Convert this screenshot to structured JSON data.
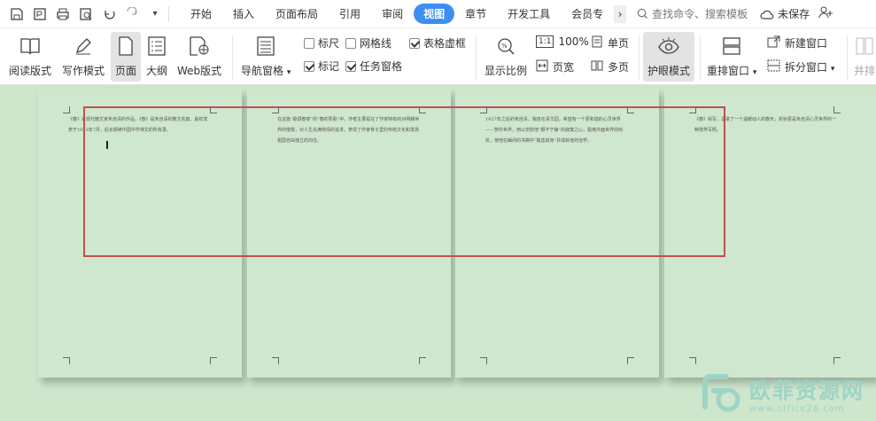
{
  "tabs": [
    "开始",
    "插入",
    "页面布局",
    "引用",
    "审阅",
    "视图",
    "章节",
    "开发工具",
    "会员专"
  ],
  "active_tab": "视图",
  "search": {
    "label": "查找命令、搜索模板"
  },
  "status": {
    "unsaved": "未保存"
  },
  "ribbon": {
    "read_mode": "阅读版式",
    "write_mode": "写作模式",
    "page": "页面",
    "outline": "大纲",
    "web": "Web版式",
    "nav_pane": "导航窗格",
    "ruler": "标尺",
    "gridlines": "网格线",
    "table_gridlines": "表格虚框",
    "markup": "标记",
    "task_pane": "任务窗格",
    "zoom_ratio": "显示比例",
    "zoom_100": "100%",
    "page_width": "页宽",
    "single_page": "单页",
    "multi_page": "多页",
    "eye_care": "护眼模式",
    "rearrange": "重排窗口",
    "new_window": "新建窗口",
    "split_window": "拆分窗口",
    "side_by_side": "并排"
  },
  "checkboxes": {
    "ruler": false,
    "gridlines": false,
    "table_gridlines": true,
    "markup": true,
    "task_pane": true
  },
  "pages": [
    {
      "text": "《春》是现代散文家朱自清的作品。《春》是朱自清的散文名篇。最初发表于1933年7月，后长期被中国中学课文的所收录。"
    },
    {
      "text": "在这篇“歌颂春意”的“春的赞歌”中，作者主要是在了作家特有的对明朗世界的憧憬，对人生充满热情的追求，表现了作家骨子里的传统文化和发扬祖国自由独立的向往。"
    },
    {
      "text": "1927年之后的朱自清，独自在清华园，希望有一个更和谐的心灵世界——梦的世界，用以安慰他“颇不宁静”的寂寞之心，脱离外面世界的纷扰，使他在幽闭的书斋中“独善其身”并成就他的治学。"
    },
    {
      "text": "《春》绘写，讴歌了一个温暖动人的春天，折射更是朱自清心灵世界的一种境界写照。"
    }
  ],
  "watermark": {
    "cn": "欧菲资源网",
    "en": "www.office26.com"
  },
  "colors": {
    "accent": "#3d8ef0",
    "highlight_box": "#c0504d",
    "eye_care_bg": "#cde6cc"
  }
}
